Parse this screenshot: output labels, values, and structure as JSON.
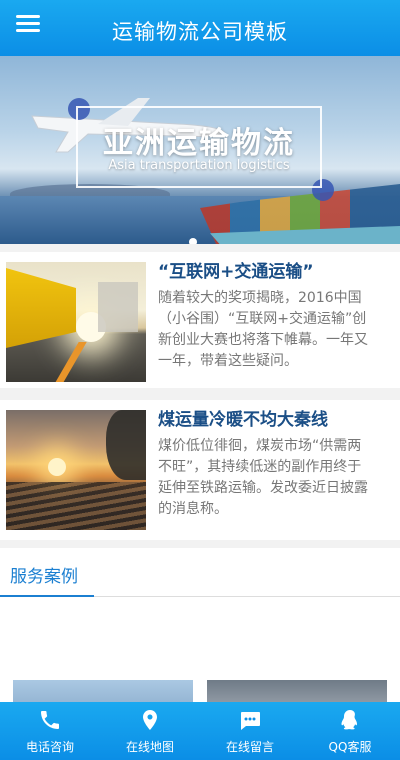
{
  "header": {
    "title": "运输物流公司模板"
  },
  "banner": {
    "title": "亚洲运输物流",
    "subtitle": "Asia transportation logistics"
  },
  "news": [
    {
      "title": "“互联网+交通运输”",
      "desc": "随着较大的奖项揭晓，2016中国（小谷围）“互联网+交通运输”创新创业大赛也将落下帷幕。一年又一年，带着这些疑问。"
    },
    {
      "title": "煤运量冷暖不均大秦线",
      "desc": "煤价低位徘徊，煤炭市场“供需两不旺”，其持续低迷的副作用终于延伸至铁路运输。发改委近日披露的消息称。"
    }
  ],
  "services": {
    "title": "服务案例"
  },
  "bottom_nav": [
    {
      "label": "电话咨询",
      "icon": "phone-icon"
    },
    {
      "label": "在线地图",
      "icon": "map-pin-icon"
    },
    {
      "label": "在线留言",
      "icon": "message-icon"
    },
    {
      "label": "QQ客服",
      "icon": "qq-icon"
    }
  ],
  "colors": {
    "primary": "#1aa9f0",
    "title_blue": "#1a4e86",
    "accent": "#1b7fd1"
  }
}
